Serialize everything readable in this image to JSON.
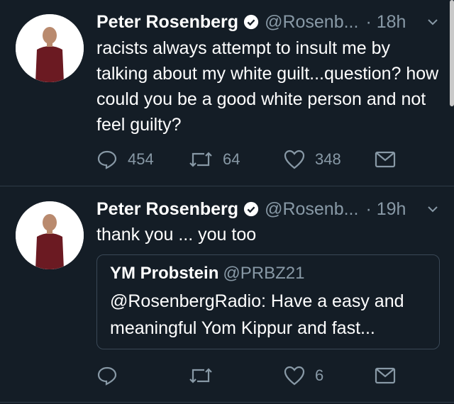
{
  "tweets": [
    {
      "author_name": "Peter Rosenberg",
      "handle": "@Rosenb...",
      "time": "· 18h",
      "text": "racists always attempt to insult me by talking about my white guilt...question? how could you be a good white person and not feel guilty?",
      "reply_count": "454",
      "retweet_count": "64",
      "like_count": "348"
    },
    {
      "author_name": "Peter Rosenberg",
      "handle": "@Rosenb...",
      "time": "· 19h",
      "text": "thank you ... you too",
      "quote": {
        "author_name": "YM Probstein",
        "handle": "@PRBZ21",
        "text": "@RosenbergRadio: Have a easy and meaningful Yom Kippur and fast..."
      },
      "reply_count": "",
      "retweet_count": "",
      "like_count": "6"
    }
  ],
  "colors": {
    "background": "#141d26",
    "secondary_text": "#8899a6",
    "divider": "#2f3b47",
    "shirt": "#6b1a22"
  },
  "icons": [
    "verified-badge-icon",
    "chevron-down-icon",
    "reply-icon",
    "retweet-icon",
    "like-icon",
    "share-mail-icon"
  ]
}
